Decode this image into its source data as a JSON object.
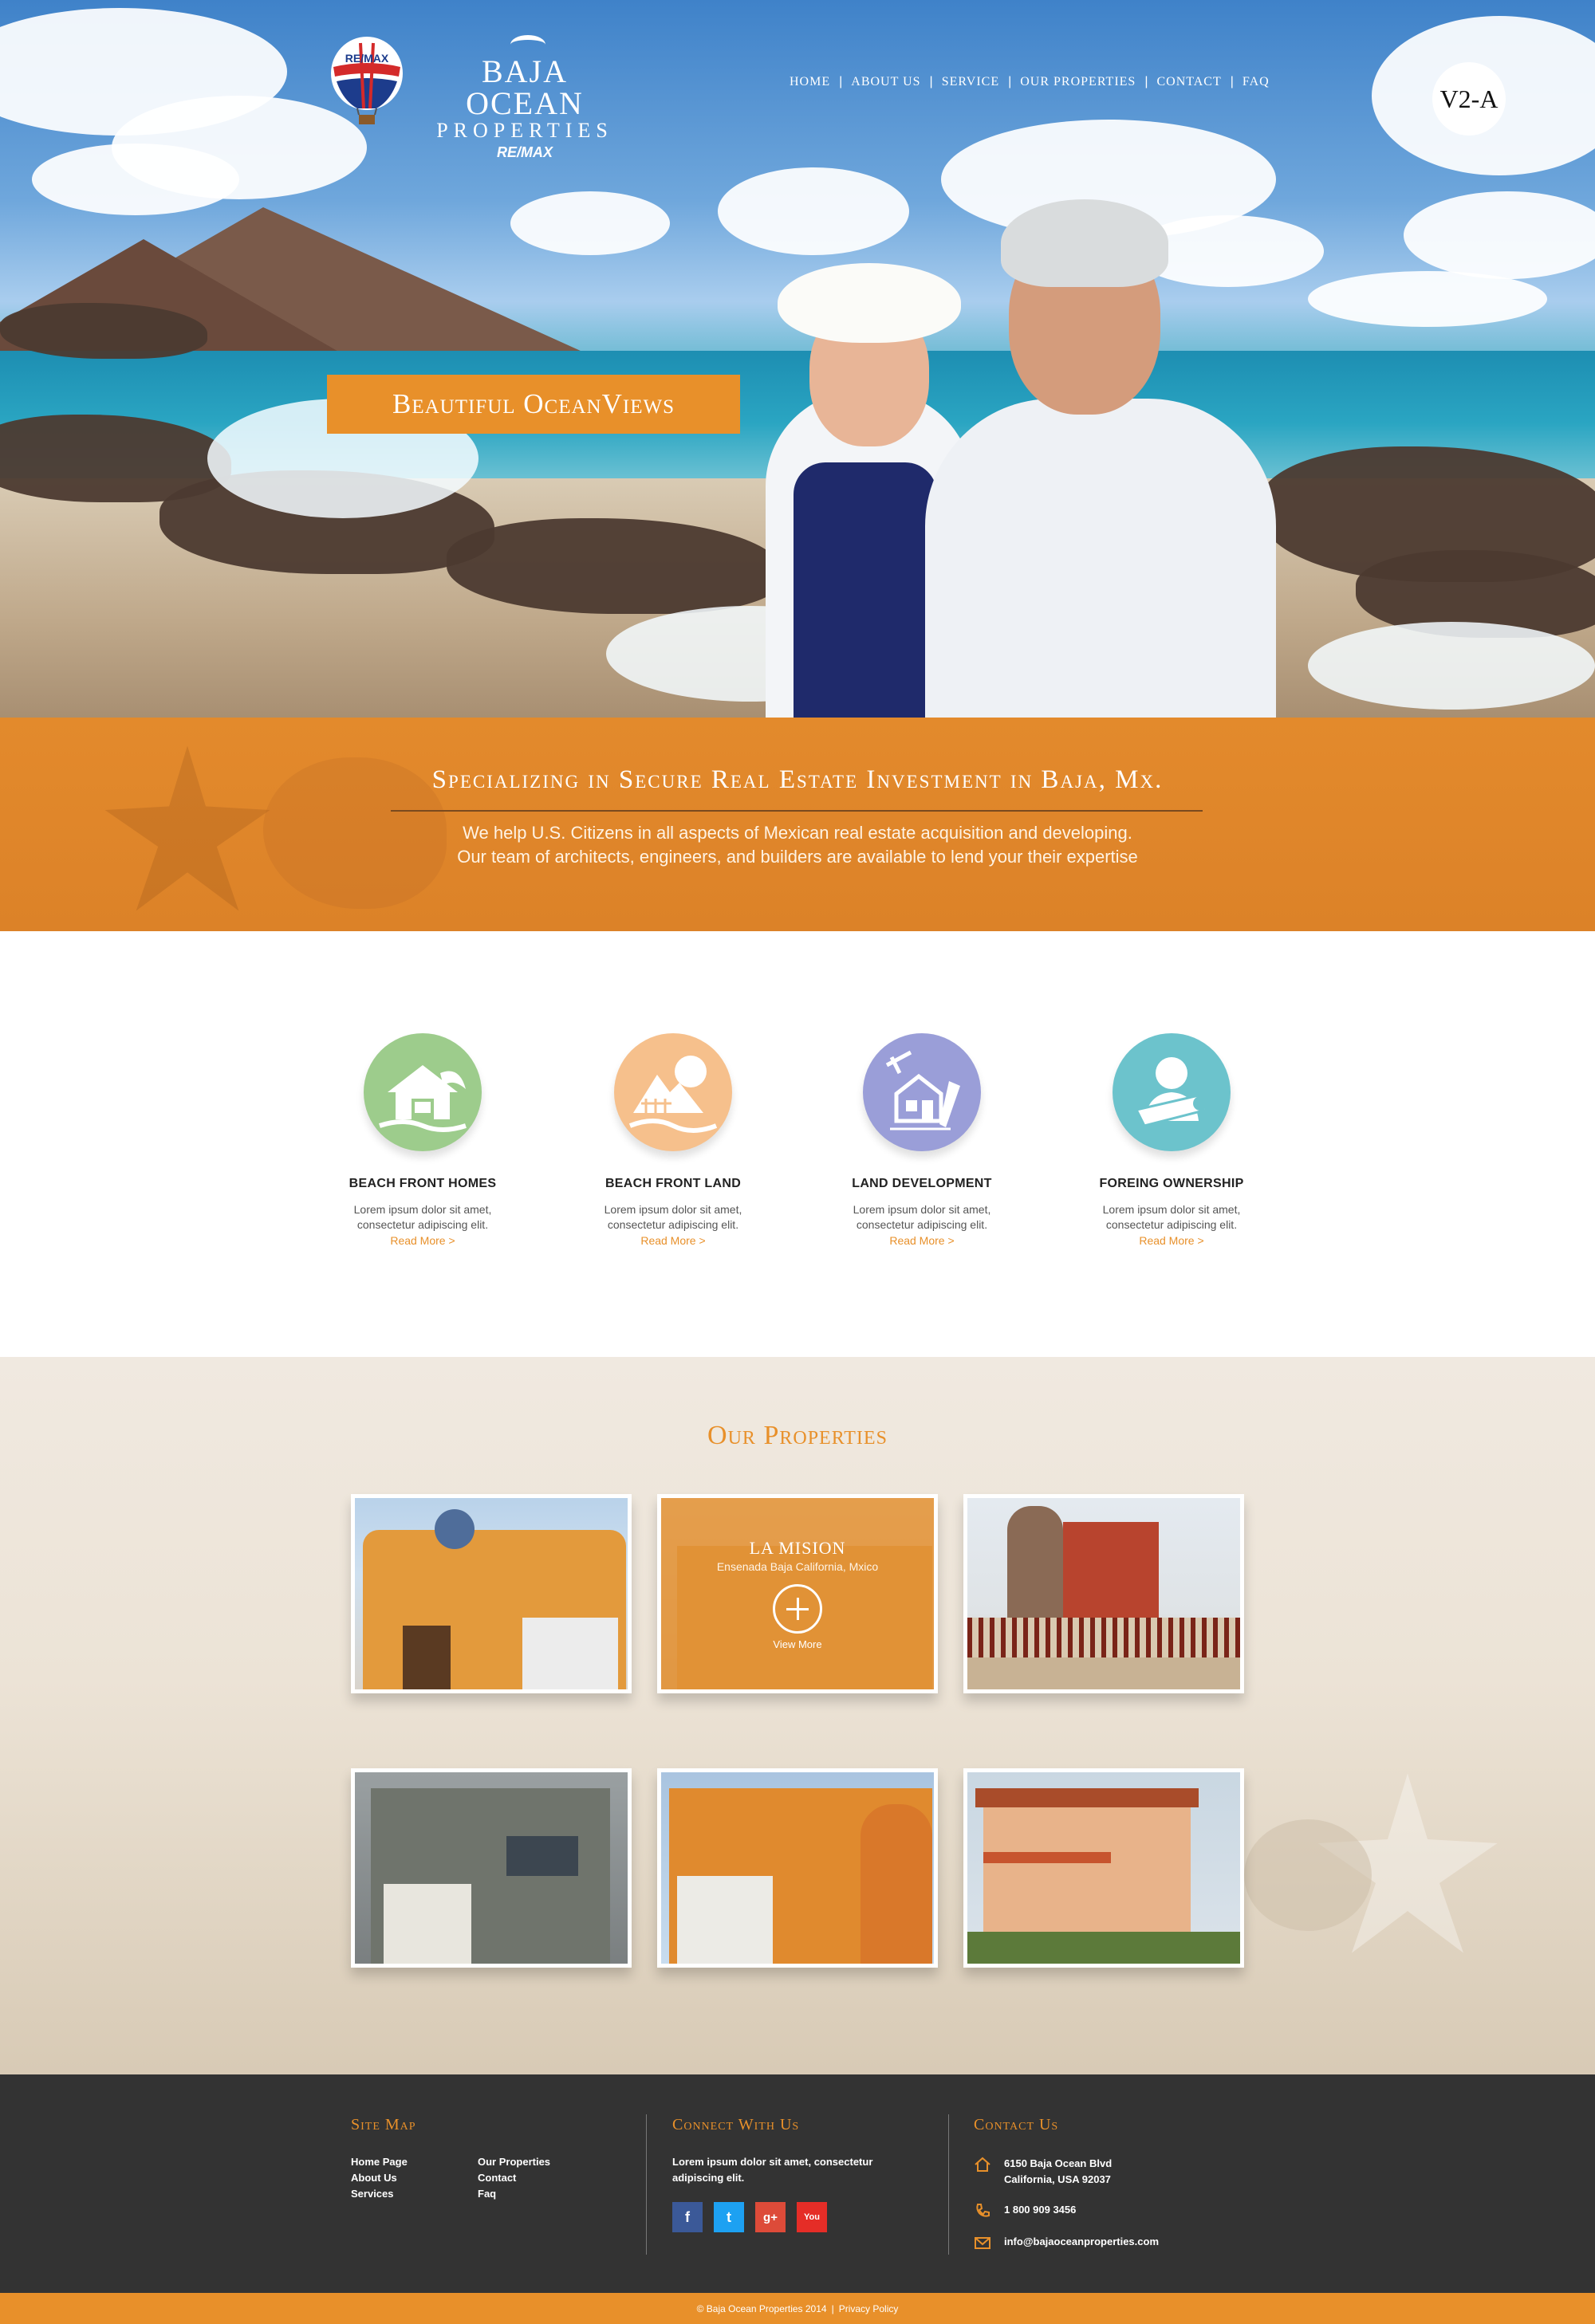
{
  "header": {
    "logo_line1": "BAJA OCEAN",
    "logo_line2": "PROPERTIES",
    "logo_brand": "RE/MAX",
    "balloon_text": "RE/MAX",
    "nav": [
      "HOME",
      "ABOUT US",
      "SERVICE",
      "OUR PROPERTIES",
      "CONTACT",
      "FAQ"
    ],
    "version_badge": "V2-A"
  },
  "hero": {
    "banner": "Beautiful OceanViews"
  },
  "intro": {
    "heading": "Specializing in Secure Real Estate Investment in Baja, Mx.",
    "line1": "We help U.S. Citizens in all aspects of Mexican real estate acquisition and developing.",
    "line2": "Our team of architects, engineers, and builders are available to lend your their expertise"
  },
  "services": [
    {
      "title": "BEACH FRONT HOMES",
      "desc1": "Lorem ipsum dolor sit amet,",
      "desc2": "consectetur adipiscing elit.",
      "more": "Read More >",
      "color": "#9dcc8c"
    },
    {
      "title": "BEACH FRONT LAND",
      "desc1": "Lorem ipsum dolor sit amet,",
      "desc2": "consectetur adipiscing elit.",
      "more": "Read More >",
      "color": "#f6c08c"
    },
    {
      "title": "LAND DEVELOPMENT",
      "desc1": "Lorem ipsum dolor sit amet,",
      "desc2": "consectetur adipiscing elit.",
      "more": "Read More >",
      "color": "#9a9ed8"
    },
    {
      "title": "FOREING OWNERSHIP",
      "desc1": "Lorem ipsum dolor sit amet,",
      "desc2": "consectetur adipiscing elit.",
      "more": "Read More >",
      "color": "#6cc3cc"
    }
  ],
  "properties": {
    "heading": "Our Properties",
    "featured": {
      "title": "LA MISION",
      "location": "Ensenada Baja California, Mxico",
      "action": "View More"
    }
  },
  "footer": {
    "sitemap": {
      "heading": "Site Map",
      "col1": [
        "Home Page",
        "About Us",
        "Services"
      ],
      "col2": [
        "Our Properties",
        "Contact",
        "Faq"
      ]
    },
    "connect": {
      "heading": "Connect With Us",
      "text": "Lorem ipsum dolor sit amet, consectetur adipiscing elit.",
      "social": [
        {
          "name": "facebook",
          "glyph": "f",
          "color": "#3b5998"
        },
        {
          "name": "twitter",
          "glyph": "t",
          "color": "#1da1f2"
        },
        {
          "name": "google-plus",
          "glyph": "g+",
          "color": "#dd4b39"
        },
        {
          "name": "youtube",
          "glyph": "You",
          "color": "#e52d27"
        }
      ]
    },
    "contact": {
      "heading": "Contact Us",
      "address1": "6150 Baja Ocean Blvd",
      "address2": "California, USA 92037",
      "phone": "1 800 909 3456",
      "email": "info@bajaoceanproperties.com"
    },
    "copyright": "© Baja Ocean Properties 2014",
    "privacy": "Privacy Policy"
  },
  "colors": {
    "accent": "#e8902a",
    "footer_bg": "#333333"
  }
}
